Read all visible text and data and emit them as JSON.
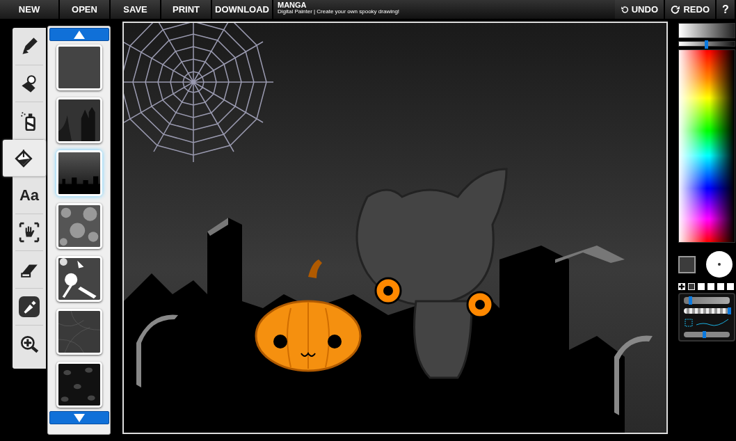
{
  "menu": [
    {
      "label": "NEW"
    },
    {
      "label": "OPEN"
    },
    {
      "label": "SAVE"
    },
    {
      "label": "PRINT"
    },
    {
      "label": "DOWNLOAD"
    }
  ],
  "app": {
    "title": "MANGA",
    "subtitle": "Digital Painter | Create your own spooky drawing!"
  },
  "history": [
    {
      "kind": "undo",
      "label": "UNDO"
    },
    {
      "kind": "redo",
      "label": "REDO"
    }
  ],
  "help": "?",
  "tools": [
    {
      "kind": "pencil",
      "selected": false,
      "on": false
    },
    {
      "kind": "stamp",
      "selected": false,
      "on": false
    },
    {
      "kind": "spray",
      "selected": false,
      "on": false
    },
    {
      "kind": "bucket",
      "selected": true,
      "on": false
    },
    {
      "kind": "text",
      "label": "Aa",
      "selected": false,
      "on": false
    },
    {
      "kind": "move",
      "selected": false,
      "on": false
    },
    {
      "kind": "eraser",
      "selected": false,
      "on": false
    },
    {
      "kind": "eyedropper",
      "selected": false,
      "on": true
    },
    {
      "kind": "zoom",
      "selected": false,
      "on": false
    }
  ],
  "backgrounds": [
    {
      "kind": "plain",
      "selected": false
    },
    {
      "kind": "haunted-house",
      "selected": false
    },
    {
      "kind": "graveyard",
      "selected": true
    },
    {
      "kind": "ghosts",
      "selected": false
    },
    {
      "kind": "candy",
      "selected": false
    },
    {
      "kind": "web",
      "selected": false
    },
    {
      "kind": "eyes",
      "selected": false
    }
  ],
  "color": {
    "shade": {
      "level": 0.49
    },
    "swatches": [
      {
        "color": "#3c3c3c"
      },
      {
        "color": "#ffffff"
      },
      {
        "color": "#ffffff"
      },
      {
        "color": "#ffffff"
      },
      {
        "color": "#ffffff"
      }
    ],
    "current": {
      "color": "#3c3c3c"
    }
  },
  "brush": {
    "size": {
      "level": 0.15
    },
    "opacity": {
      "level": 1.0
    },
    "smoothing": {
      "level": 0.45
    }
  }
}
